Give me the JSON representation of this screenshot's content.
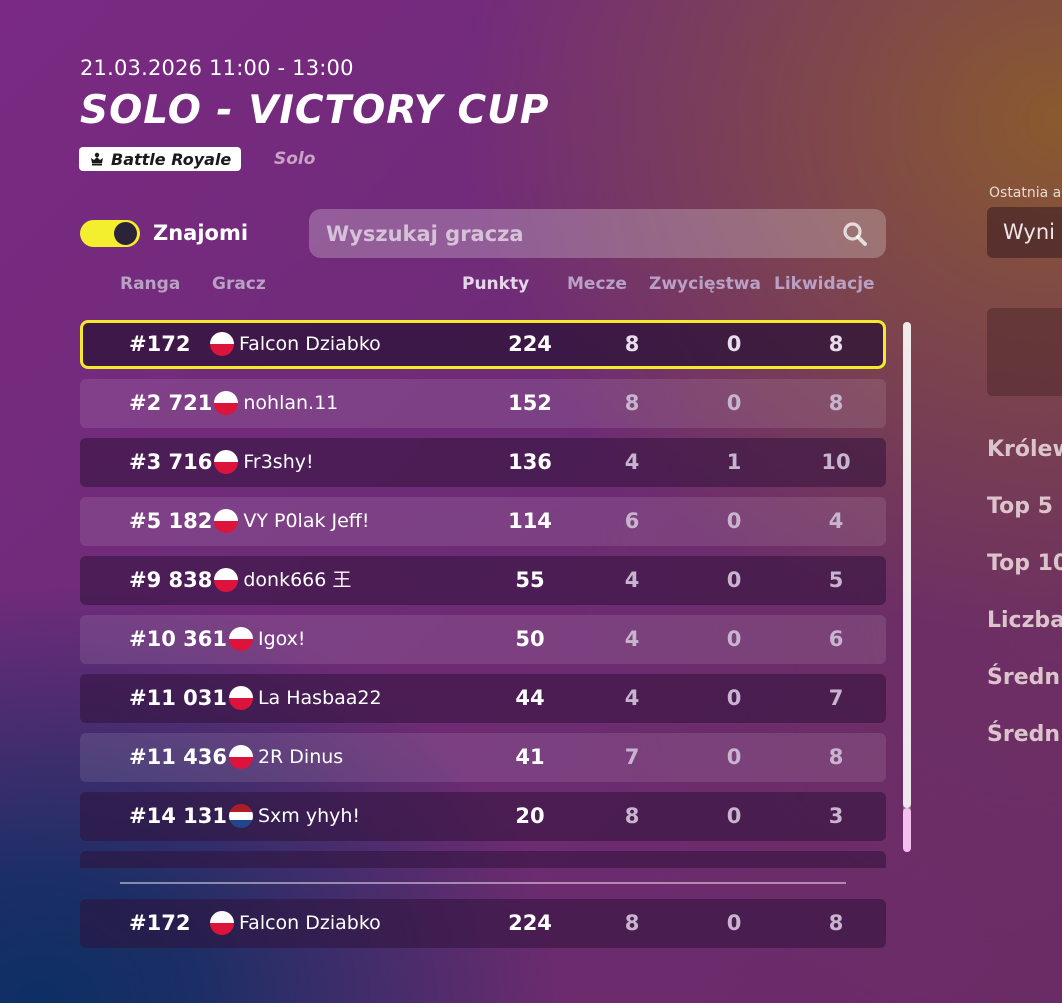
{
  "event": {
    "datetime": "21.03.2026 11:00 - 13:00",
    "title": "SOLO - VICTORY CUP",
    "mode": "Battle Royale",
    "submode": "Solo"
  },
  "filters": {
    "friends_label": "Znajomi",
    "friends_on": true,
    "search_placeholder": "Wyszukaj gracza"
  },
  "columns": {
    "rank": "Ranga",
    "player": "Gracz",
    "points": "Punkty",
    "matches": "Mecze",
    "wins": "Zwycięstwa",
    "eliminations": "Likwidacje"
  },
  "rows": [
    {
      "rank": "#172",
      "flag": "PL",
      "name": "Falcon Dziabko",
      "points": "224",
      "matches": "8",
      "wins": "0",
      "elims": "8"
    },
    {
      "rank": "#2 721",
      "flag": "PL",
      "name": "nohlan.11",
      "points": "152",
      "matches": "8",
      "wins": "0",
      "elims": "8"
    },
    {
      "rank": "#3 716",
      "flag": "PL",
      "name": "Fr3shy!",
      "points": "136",
      "matches": "4",
      "wins": "1",
      "elims": "10"
    },
    {
      "rank": "#5 182",
      "flag": "PL",
      "name": "VY P0lak Jeff!",
      "points": "114",
      "matches": "6",
      "wins": "0",
      "elims": "4"
    },
    {
      "rank": "#9 838",
      "flag": "PL",
      "name": "donk666 王",
      "points": "55",
      "matches": "4",
      "wins": "0",
      "elims": "5"
    },
    {
      "rank": "#10 361",
      "flag": "PL",
      "name": "Igox!",
      "points": "50",
      "matches": "4",
      "wins": "0",
      "elims": "6"
    },
    {
      "rank": "#11 031",
      "flag": "PL",
      "name": "La Hasbaa22",
      "points": "44",
      "matches": "4",
      "wins": "0",
      "elims": "7"
    },
    {
      "rank": "#11 436",
      "flag": "PL",
      "name": "2R Dinus",
      "points": "41",
      "matches": "7",
      "wins": "0",
      "elims": "8"
    },
    {
      "rank": "#14 131",
      "flag": "NL",
      "name": "Sxm yhyh!",
      "points": "20",
      "matches": "8",
      "wins": "0",
      "elims": "3"
    }
  ],
  "my_row": {
    "rank": "#172",
    "flag": "PL",
    "name": "Falcon Dziabko",
    "points": "224",
    "matches": "8",
    "wins": "0",
    "elims": "8"
  },
  "right_panel": {
    "select_label": "Ostatnia a",
    "select_value": "Wyni",
    "stats": [
      "Królew",
      "Top 5",
      "Top 10",
      "Liczba",
      "Średn",
      "Średn"
    ]
  },
  "colors": {
    "highlight": "#f2ea2a",
    "toggle_on": "#f4ef2e",
    "flag_pl_white": "#ffffff",
    "flag_pl_red": "#dc143c"
  },
  "icons": {
    "search": "search-icon",
    "crown": "crown-icon",
    "flag_pl": "flag-poland-icon",
    "flag_nl": "flag-netherlands-icon"
  }
}
